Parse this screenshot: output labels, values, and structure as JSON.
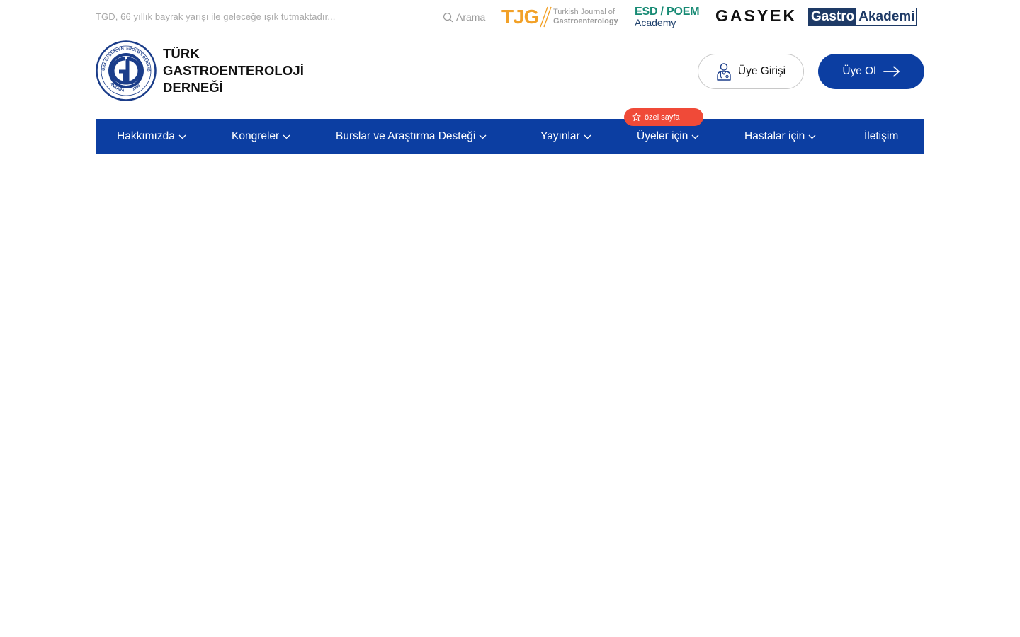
{
  "topbar": {
    "tagline": "TGD, 66 yıllık bayrak yarışı ile geleceğe ışık tutmaktadır...",
    "search_label": "Arama",
    "partners": {
      "tjg": {
        "mark": "TJG",
        "line1": "Turkish Journal of",
        "line2": "Gastroenterology"
      },
      "esd": {
        "title": "ESD / POEM",
        "subtitle": "Academy"
      },
      "gasyek": {
        "mark": "GASYEK"
      },
      "gastro_akademi": {
        "part1": "Gastro",
        "part2": "Akademi"
      }
    }
  },
  "header": {
    "logo": {
      "lines": [
        "TÜRK",
        "GASTROENTEROLOJİ",
        "DERNEĞİ"
      ],
      "seal_text": "TÜRK GASTROENTEROLOJİ DERNEĞİ",
      "seal_city": "ANKARA",
      "seal_year": "1959"
    },
    "login_label": "Üye Girişi",
    "register_label": "Üye Ol"
  },
  "nav": {
    "items": [
      {
        "label": "Hakkımızda",
        "has_dropdown": true
      },
      {
        "label": "Kongreler",
        "has_dropdown": true
      },
      {
        "label": "Burslar ve Araştırma Desteği",
        "has_dropdown": true
      },
      {
        "label": "Yayınlar",
        "has_dropdown": true
      },
      {
        "label": "Üyeler için",
        "has_dropdown": true
      },
      {
        "label": "Hastalar için",
        "has_dropdown": true
      },
      {
        "label": "İletişim",
        "has_dropdown": false
      }
    ],
    "badge_label": "özel sayfa"
  },
  "colors": {
    "primary": "#0c3ea2",
    "badge": "#f04a38",
    "tjg": "#f2a128",
    "esd": "#178a74",
    "gastro_navy": "#1e3a66",
    "tagline": "#a9a9a9"
  },
  "icons": [
    "search-icon",
    "doctor-icon",
    "arrow-right-icon",
    "chevron-down-icon",
    "star-icon"
  ]
}
